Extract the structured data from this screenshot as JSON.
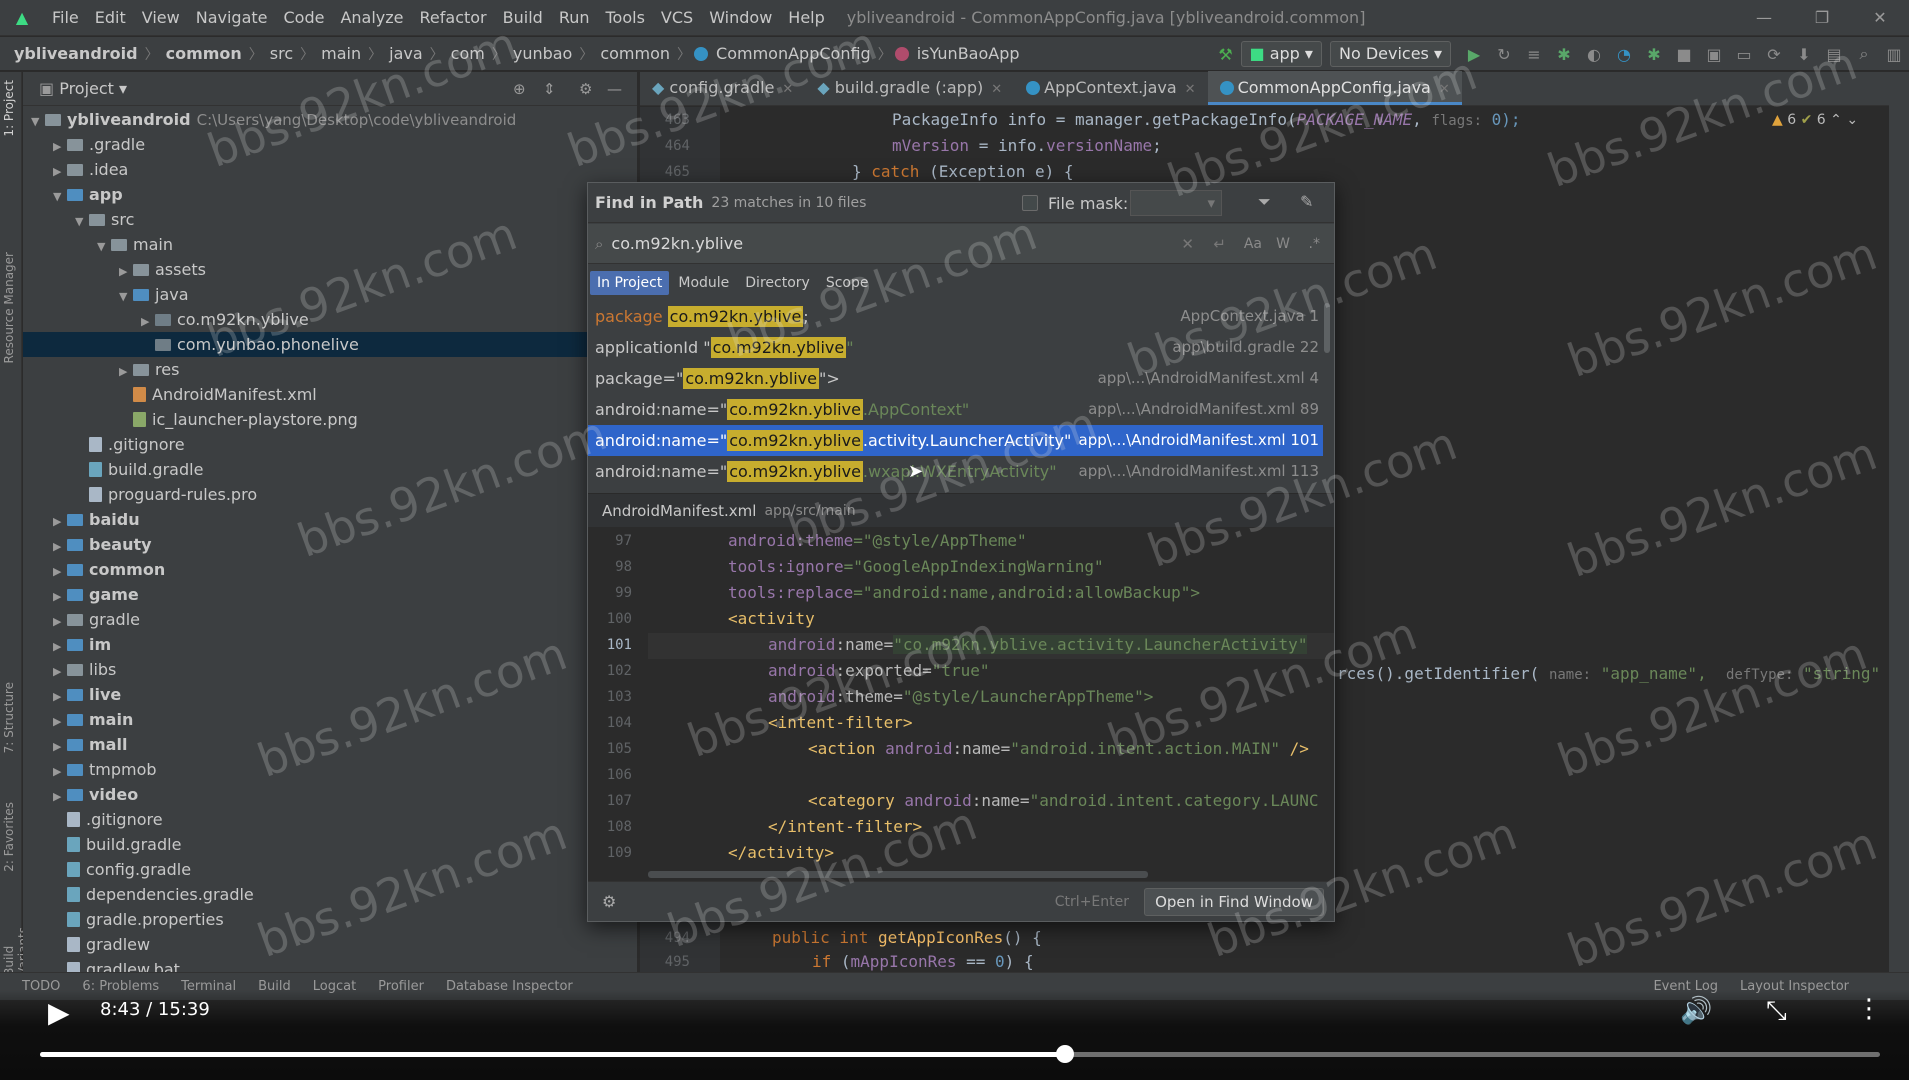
{
  "menubar": {
    "items": [
      "File",
      "Edit",
      "View",
      "Navigate",
      "Code",
      "Analyze",
      "Refactor",
      "Build",
      "Run",
      "Tools",
      "VCS",
      "Window",
      "Help"
    ],
    "window_title": "ybliveandroid - CommonAppConfig.java [ybliveandroid.common]"
  },
  "navbar": {
    "crumbs": [
      "ybliveandroid",
      "common",
      "src",
      "main",
      "java",
      "com",
      "yunbao",
      "common"
    ],
    "class_crumb": "CommonAppConfig",
    "method_crumb": "isYunBaoApp",
    "run_config": "app",
    "devices": "No Devices"
  },
  "project": {
    "title": "Project",
    "root_name": "ybliveandroid",
    "root_path": "C:\\Users\\yang\\Desktop\\code\\ybliveandroid",
    "tree": [
      ".gradle",
      ".idea",
      "app",
      "src",
      "main",
      "assets",
      "java",
      "co.m92kn.yblive",
      "com.yunbao.phonelive",
      "res",
      "AndroidManifest.xml",
      "ic_launcher-playstore.png",
      ".gitignore",
      "build.gradle",
      "proguard-rules.pro",
      "baidu",
      "beauty",
      "common",
      "game",
      "gradle",
      "im",
      "libs",
      "live",
      "main",
      "mall",
      "tmpmob",
      "video",
      ".gitignore",
      "build.gradle",
      "config.gradle",
      "dependencies.gradle",
      "gradle.properties",
      "gradlew",
      "gradlew.bat"
    ]
  },
  "left_strip": [
    "1: Project",
    "Resource Manager",
    "7: Structure",
    "2: Favorites",
    "Build Variants"
  ],
  "tabs": [
    "config.gradle",
    "build.gradle (:app)",
    "AppContext.java",
    "CommonAppConfig.java"
  ],
  "inspections": {
    "warnings": "6",
    "weak": "6"
  },
  "editor": {
    "line_463": "463",
    "line_464": "464",
    "line_465": "465",
    "line_494": "494",
    "line_495": "495",
    "code_463_a": "PackageInfo info = manager.getPackageInfo(",
    "code_463_b": "PACKAGE_NAME",
    "code_463_c": ",",
    "code_463_hint": "flags:",
    "code_463_d": " 0);",
    "code_464_a": "mVersion",
    "code_464_b": " = info.",
    "code_464_c": "versionName",
    "code_464_d": ";",
    "code_465_a": "} ",
    "code_465_b": "catch",
    "code_465_c": " (Exception e) {",
    "code_right_a": "rces().getIdentifier(",
    "code_right_hint1": "name:",
    "code_right_b": "\"app_name\",",
    "code_right_hint2": "defType:",
    "code_right_c": "\"string\"",
    "code_494_a": "public int ",
    "code_494_b": "getAppIconRes",
    "code_494_c": "() {",
    "code_495_a": "if",
    "code_495_b": " (",
    "code_495_c": "mAppIconRes",
    "code_495_d": " == ",
    "code_495_e": "0",
    "code_495_f": ") {"
  },
  "find": {
    "title": "Find in Path",
    "count": "23 matches in 10 files",
    "file_mask_label": "File mask:",
    "query": "co.m92kn.yblive",
    "scopes": [
      "In Project",
      "Module",
      "Directory",
      "Scope"
    ],
    "results": [
      {
        "prefix": "package ",
        "match": "co.m92kn.yblive",
        "suffix": ";",
        "loc": "AppContext.java 1"
      },
      {
        "prefix": "applicationId \"",
        "match": "co.m92kn.yblive",
        "suffix": "\"",
        "loc": "app\\build.gradle 22"
      },
      {
        "prefix": "package=\"",
        "match": "co.m92kn.yblive",
        "suffix": "\">",
        "loc": "app\\...\\AndroidManifest.xml 4"
      },
      {
        "prefix": "android:name=\"",
        "match": "co.m92kn.yblive",
        "suffix": ".AppContext\"",
        "loc": "app\\...\\AndroidManifest.xml 89"
      },
      {
        "prefix": "android:name=\"",
        "match": "co.m92kn.yblive",
        "suffix": ".activity.LauncherActivity\"",
        "loc": "app\\...\\AndroidManifest.xml 101"
      },
      {
        "prefix": "android:name=\"",
        "match": "co.m92kn.yblive",
        "suffix": ".wxapi.WXEntryActivity\"",
        "loc": "app\\...\\AndroidManifest.xml 113"
      }
    ],
    "preview_file": "AndroidManifest.xml",
    "preview_path": "app/src/main",
    "preview_lines": [
      "97",
      "98",
      "99",
      "100",
      "101",
      "102",
      "103",
      "104",
      "105",
      "106",
      "107",
      "108",
      "109"
    ],
    "p97_a": "android:theme",
    "p97_b": "=\"@style/AppTheme\"",
    "p98_a": "tools:ignore",
    "p98_b": "=\"GoogleAppIndexingWarning\"",
    "p99_a": "tools:replace",
    "p99_b": "=\"android:name,android:allowBackup\">",
    "p100": "<activity",
    "p101_a": "android",
    "p101_b": ":name=",
    "p101_c": "\"co.m92kn.yblive.activity.LauncherActivity\"",
    "p102_a": "android",
    "p102_b": ":exported=",
    "p102_c": "\"true\"",
    "p103_a": "android",
    "p103_b": ":theme=",
    "p103_c": "\"@style/LauncherAppTheme\">",
    "p104": "<intent-filter>",
    "p105_a": "<action ",
    "p105_b": "android",
    "p105_c": ":name=",
    "p105_d": "\"android.intent.action.MAIN\"",
    "p105_e": " />",
    "p107_a": "<category ",
    "p107_b": "android",
    "p107_c": ":name=",
    "p107_d": "\"android.intent.category.LAUNC",
    "p108": "</intent-filter>",
    "p109": "</activity>",
    "shortcut": "Ctrl+Enter",
    "open_button": "Open in Find Window"
  },
  "statusbar": [
    "TODO",
    "6: Problems",
    "Terminal",
    "Build",
    "Logcat",
    "Profiler",
    "Database Inspector",
    "Event Log",
    "Layout Inspector"
  ],
  "video": {
    "time": "8:43 / 15:39",
    "progress": 0.557
  },
  "watermark": "bbs.92kn.com"
}
